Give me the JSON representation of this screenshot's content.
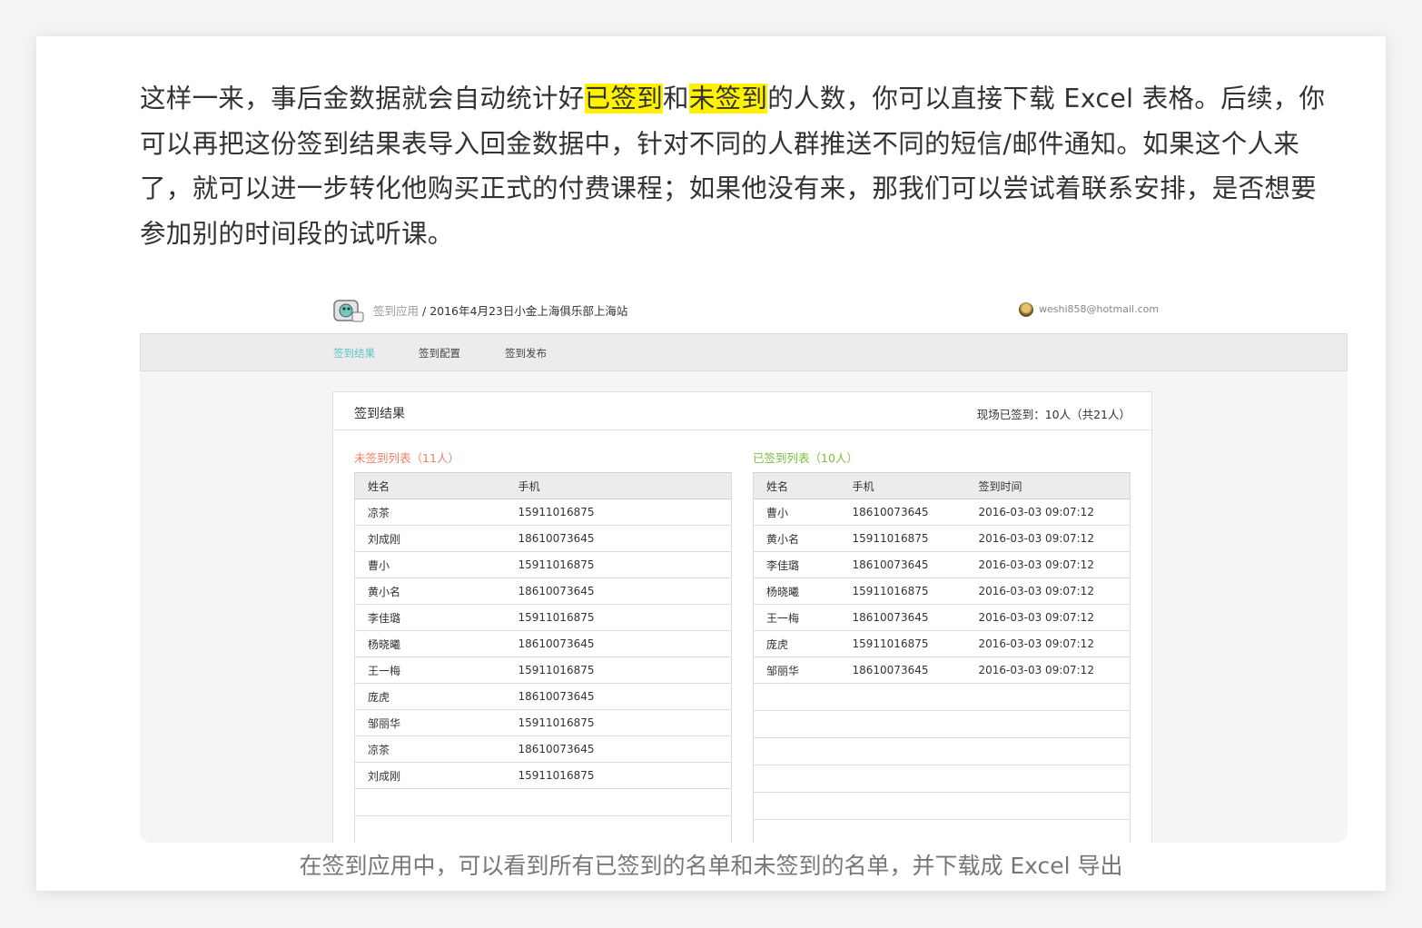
{
  "article": {
    "before": "这样一来，事后金数据就会自动统计好",
    "highlight1": "已签到",
    "mid": "和",
    "highlight2": "未签到",
    "after": "的人数，你可以直接下载 Excel 表格。后续，你可以再把这份签到结果表导入回金数据中，针对不同的人群推送不同的短信/邮件通知。如果这个人来了，就可以进一步转化他购买正式的付费课程；如果他没有来，那我们可以尝试着联系安排，是否想要参加别的时间段的试听课。"
  },
  "screenshot": {
    "breadcrumb_app": "签到应用",
    "breadcrumb_sep": " / ",
    "breadcrumb_event": "2016年4月23日小金上海俱乐部上海站",
    "user_email": "weshi858@hotmail.com",
    "tabs": [
      "签到结果",
      "签到配置",
      "签到发布"
    ],
    "panel_title": "签到结果",
    "panel_count": "现场已签到：10人（共21人）",
    "absent": {
      "title": "未签到列表（11人）",
      "headers": [
        "姓名",
        "手机"
      ],
      "rows": [
        [
          "凉茶",
          "15911016875"
        ],
        [
          "刘成刚",
          "18610073645"
        ],
        [
          "曹小",
          "15911016875"
        ],
        [
          "黄小名",
          "18610073645"
        ],
        [
          "李佳璐",
          "15911016875"
        ],
        [
          "杨晓曦",
          "18610073645"
        ],
        [
          "王一梅",
          "15911016875"
        ],
        [
          "庞虎",
          "18610073645"
        ],
        [
          "邹丽华",
          "15911016875"
        ],
        [
          "凉茶",
          "18610073645"
        ],
        [
          "刘成刚",
          "15911016875"
        ]
      ]
    },
    "present": {
      "title": "已签到列表（10人）",
      "headers": [
        "姓名",
        "手机",
        "签到时间"
      ],
      "rows": [
        [
          "曹小",
          "18610073645",
          "2016-03-03  09:07:12"
        ],
        [
          "黄小名",
          "15911016875",
          "2016-03-03  09:07:12"
        ],
        [
          "李佳璐",
          "18610073645",
          "2016-03-03  09:07:12"
        ],
        [
          "杨晓曦",
          "15911016875",
          "2016-03-03  09:07:12"
        ],
        [
          "王一梅",
          "18610073645",
          "2016-03-03  09:07:12"
        ],
        [
          "庞虎",
          "15911016875",
          "2016-03-03  09:07:12"
        ],
        [
          "邹丽华",
          "18610073645",
          "2016-03-03  09:07:12"
        ]
      ]
    }
  },
  "caption": "在签到应用中，可以看到所有已签到的名单和未签到的名单，并下载成 Excel 导出",
  "colors": {
    "highlight": "#fff200",
    "active_tab": "#5bc4c6",
    "absent_title": "#f07d65",
    "present_title": "#7cbd3c"
  },
  "icons": [
    "app-logo-icon",
    "user-avatar-icon"
  ]
}
